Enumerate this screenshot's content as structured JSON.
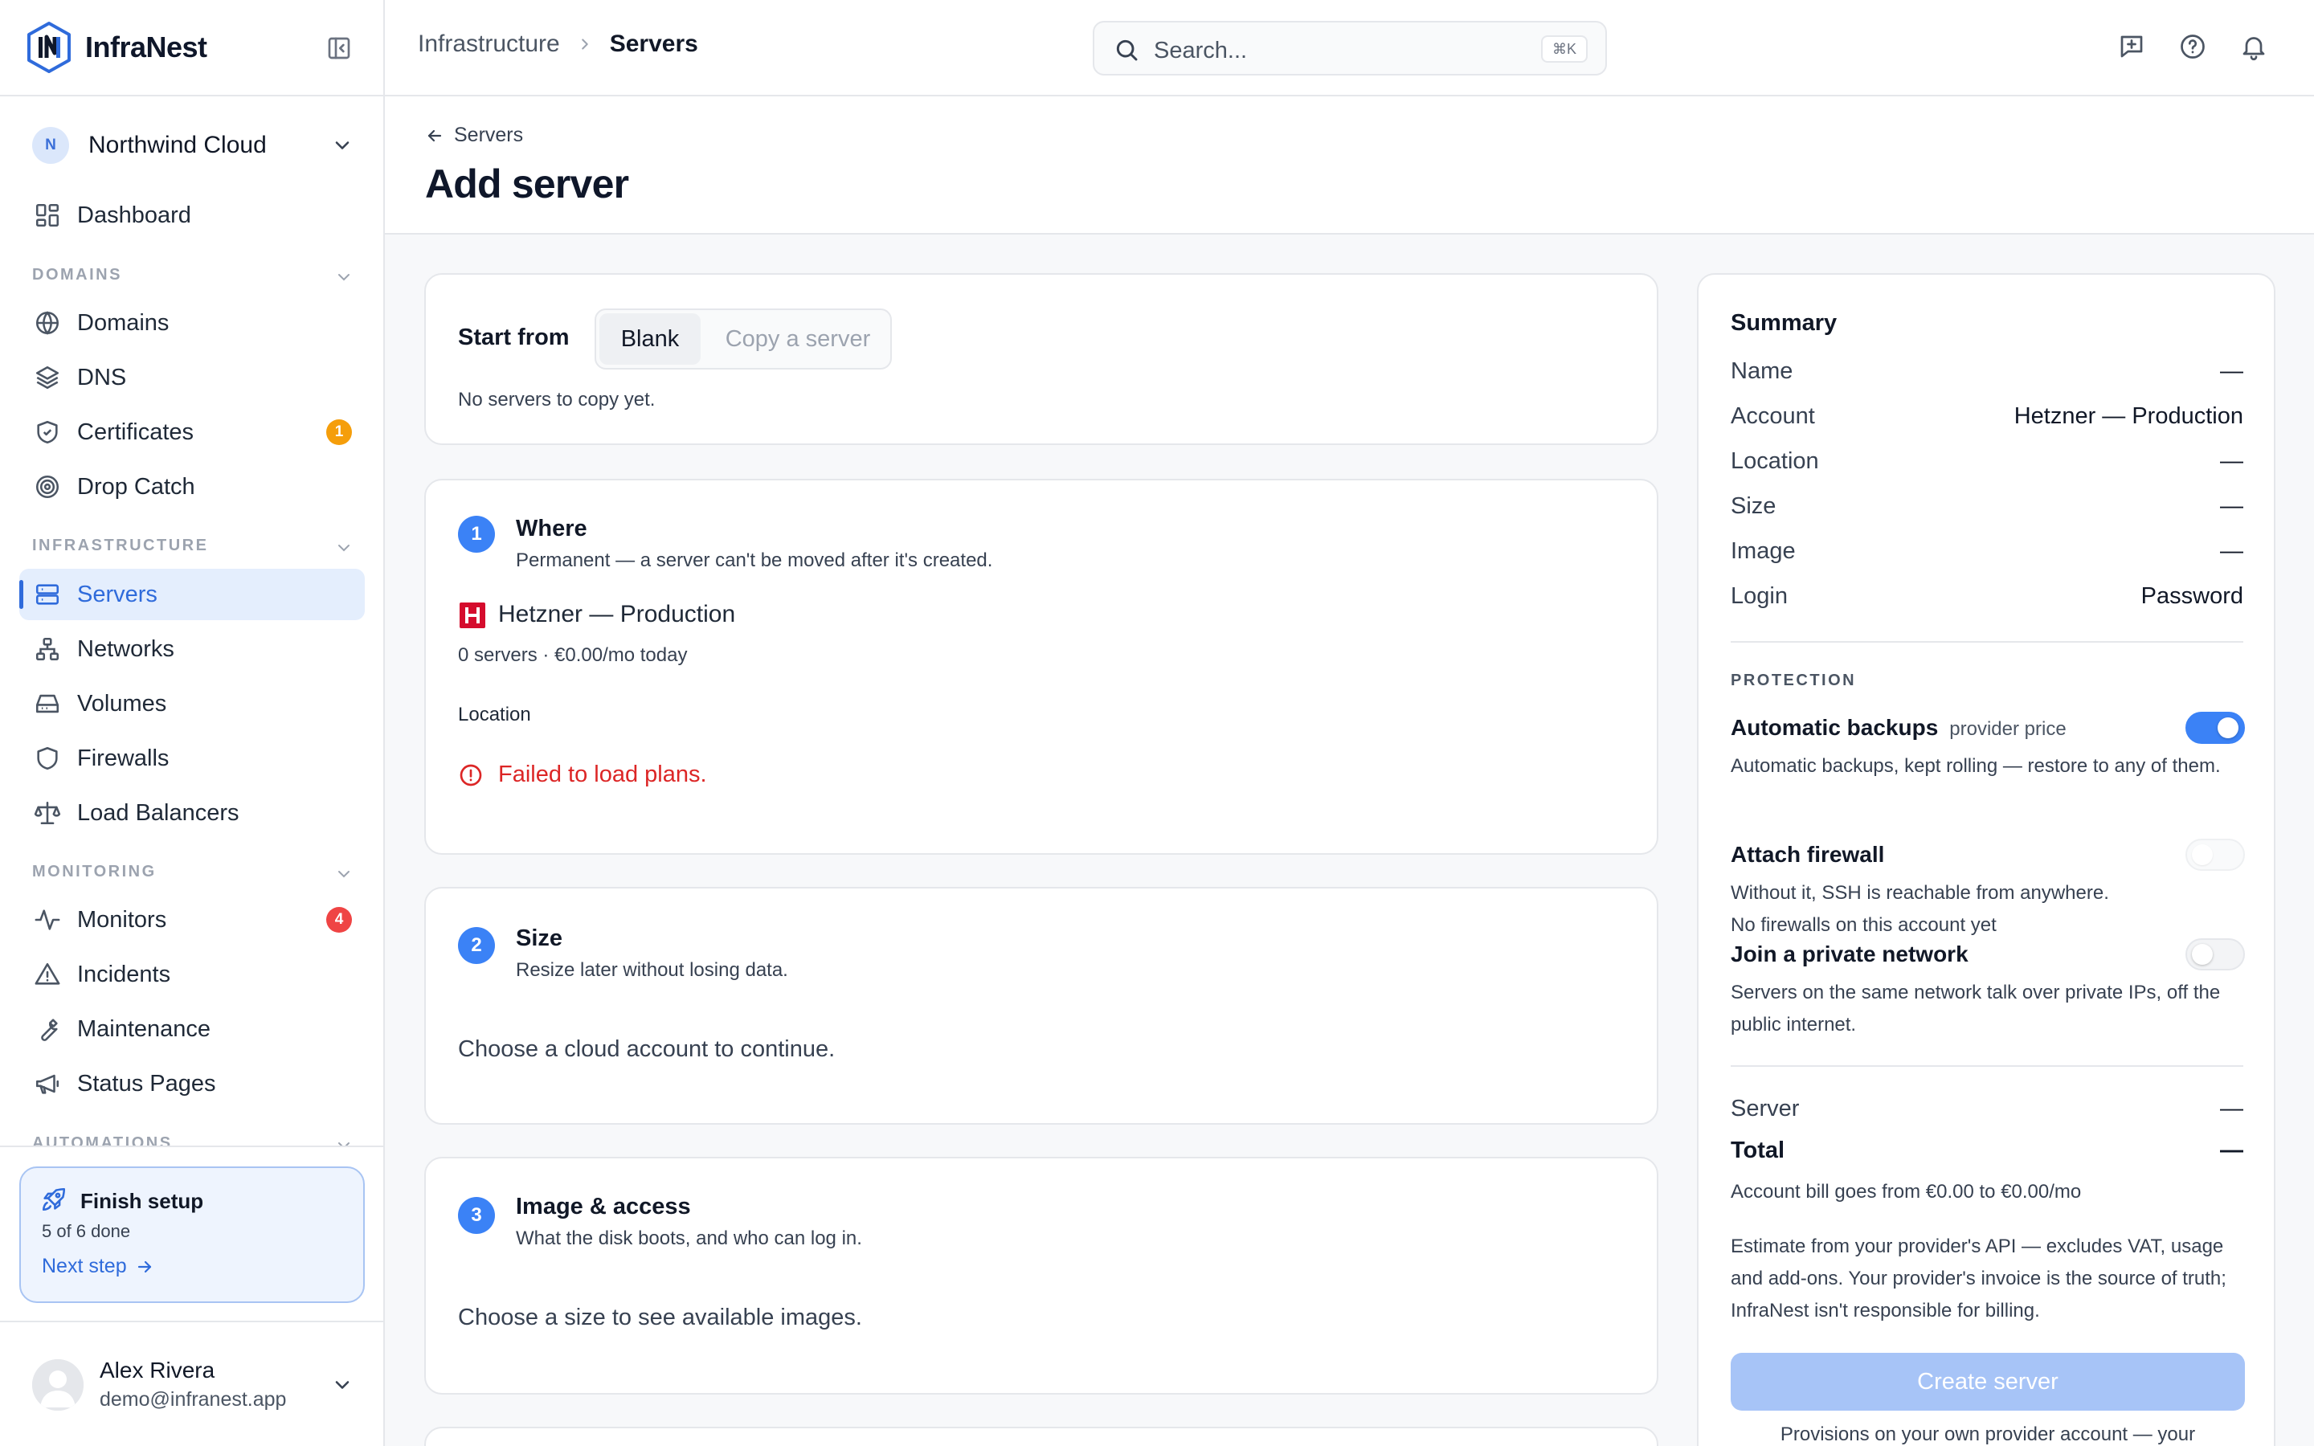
{
  "brand": {
    "name": "InfraNest"
  },
  "org": {
    "initial": "N",
    "name": "Northwind Cloud"
  },
  "sidebar": {
    "dashboard": "Dashboard",
    "sections": {
      "domains": "DOMAINS",
      "infrastructure": "INFRASTRUCTURE",
      "monitoring": "MONITORING",
      "automations": "AUTOMATIONS"
    },
    "domains_items": [
      {
        "label": "Domains",
        "icon": "globe-icon"
      },
      {
        "label": "DNS",
        "icon": "layers-icon"
      },
      {
        "label": "Certificates",
        "icon": "shield-check-icon",
        "badge": "1"
      },
      {
        "label": "Drop Catch",
        "icon": "target-icon"
      }
    ],
    "infrastructure_items": [
      {
        "label": "Servers",
        "icon": "server-icon",
        "active": true
      },
      {
        "label": "Networks",
        "icon": "network-icon"
      },
      {
        "label": "Volumes",
        "icon": "hard-drive-icon"
      },
      {
        "label": "Firewalls",
        "icon": "shield-icon"
      },
      {
        "label": "Load Balancers",
        "icon": "scale-icon"
      }
    ],
    "monitoring_items": [
      {
        "label": "Monitors",
        "icon": "activity-icon",
        "badge": "4"
      },
      {
        "label": "Incidents",
        "icon": "alert-triangle-icon"
      },
      {
        "label": "Maintenance",
        "icon": "wrench-icon"
      },
      {
        "label": "Status Pages",
        "icon": "megaphone-icon"
      }
    ]
  },
  "setup": {
    "title": "Finish setup",
    "progress": "5 of 6 done",
    "link": "Next step"
  },
  "user": {
    "name": "Alex Rivera",
    "email": "demo@infranest.app"
  },
  "topbar": {
    "breadcrumb": [
      "Infrastructure",
      "Servers"
    ],
    "search_placeholder": "Search...",
    "search_shortcut": "⌘K"
  },
  "page": {
    "back_label": "Servers",
    "title": "Add server"
  },
  "start_from": {
    "label": "Start from",
    "options": [
      "Blank",
      "Copy a server"
    ],
    "selected": "Blank",
    "note": "No servers to copy yet."
  },
  "steps": {
    "where": {
      "number": "1",
      "title": "Where",
      "subtitle": "Permanent — a server can't be moved after it's created.",
      "provider_name": "Hetzner — Production",
      "provider_meta": "0 servers · €0.00/mo today",
      "location_label": "Location",
      "error": "Failed to load plans."
    },
    "size": {
      "number": "2",
      "title": "Size",
      "subtitle": "Resize later without losing data.",
      "placeholder": "Choose a cloud account to continue."
    },
    "image": {
      "number": "3",
      "title": "Image & access",
      "subtitle": "What the disk boots, and who can log in.",
      "placeholder": "Choose a size to see available images."
    }
  },
  "summary": {
    "title": "Summary",
    "rows": [
      {
        "key": "Name",
        "value": "—"
      },
      {
        "key": "Account",
        "value": "Hetzner — Production"
      },
      {
        "key": "Location",
        "value": "—"
      },
      {
        "key": "Size",
        "value": "—"
      },
      {
        "key": "Image",
        "value": "—"
      },
      {
        "key": "Login",
        "value": "Password"
      }
    ],
    "protection_heading": "PROTECTION",
    "backups": {
      "title": "Automatic backups",
      "tag": "provider price",
      "enabled": true,
      "desc": "Automatic backups, kept rolling — restore to any of them."
    },
    "firewall": {
      "title": "Attach firewall",
      "enabled": false,
      "desc": "Without it, SSH is reachable from anywhere.",
      "note": "No firewalls on this account yet"
    },
    "private_network": {
      "title": "Join a private network",
      "enabled": false,
      "desc": "Servers on the same network talk over private IPs, off the public internet."
    },
    "server_label": "Server",
    "server_value": "—",
    "total_label": "Total",
    "total_value": "—",
    "bill_line": "Account bill goes from €0.00 to €0.00/mo",
    "disclaimer": "Estimate from your provider's API — excludes VAT, usage and add-ons. Your provider's invoice is the source of truth; InfraNest isn't responsible for billing.",
    "create_button": "Create server",
    "footnote": "Provisions on your own provider account — your"
  },
  "colors": {
    "accent": "#2f6bdb",
    "step_badge": "#3b82f6",
    "error": "#dc2626",
    "badge_amber": "#f59e0b",
    "badge_red": "#ef4444",
    "provider_red": "#d50c2d"
  }
}
